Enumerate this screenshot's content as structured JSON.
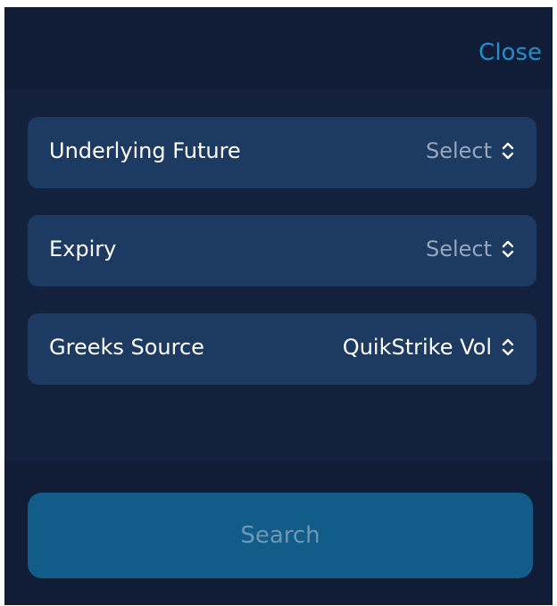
{
  "header": {
    "close_label": "Close"
  },
  "form": {
    "rows": [
      {
        "label": "Underlying Future",
        "value": "Select"
      },
      {
        "label": "Expiry",
        "value": "Select"
      },
      {
        "label": "Greeks Source",
        "value": "QuikStrike Vol"
      }
    ]
  },
  "footer": {
    "search_label": "Search"
  },
  "colors": {
    "background": "#13213f",
    "row_background": "#1d3a63",
    "accent": "#1f8fd0",
    "button_background": "#125c8a",
    "button_text_disabled": "#6f96b4"
  },
  "icons": {
    "row_chevron": "chevron-up-down-icon"
  }
}
